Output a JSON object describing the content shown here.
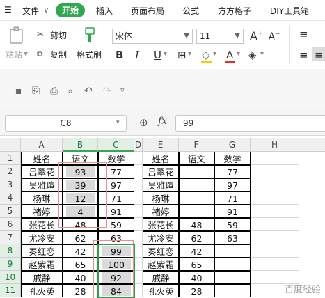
{
  "menu": {
    "file": "文件",
    "start": "开始",
    "items": [
      "插入",
      "页面布局",
      "公式",
      "方方格子",
      "DIY工具箱"
    ]
  },
  "ribbon": {
    "paste": "粘贴",
    "cut": "剪切",
    "copy": "复制",
    "format_painter": "格式刷",
    "font_name": "宋体",
    "font_size": "11",
    "bold": "B",
    "italic": "I",
    "underline": "U",
    "font_color_letter": "A"
  },
  "formula_bar": {
    "cell_ref": "C8",
    "fx": "fx",
    "value": "99"
  },
  "columns": [
    "A",
    "B",
    "C",
    "D",
    "E",
    "F",
    "G",
    "H"
  ],
  "rows": [
    "1",
    "2",
    "3",
    "4",
    "5",
    "6",
    "7",
    "8",
    "9",
    "10",
    "11"
  ],
  "left_table": {
    "headers": [
      "姓名",
      "语文",
      "数学"
    ],
    "rows": [
      [
        "吕翠花",
        "93",
        "77"
      ],
      [
        "吴雅瑄",
        "39",
        "97"
      ],
      [
        "杨琳",
        "12",
        "71"
      ],
      [
        "褚婷",
        "4",
        "91"
      ],
      [
        "张花长",
        "48",
        "59"
      ],
      [
        "尤冷安",
        "62",
        "63"
      ],
      [
        "秦红恋",
        "42",
        "99"
      ],
      [
        "赵紫霜",
        "65",
        "100"
      ],
      [
        "戚静",
        "40",
        "92"
      ],
      [
        "孔火英",
        "28",
        "84"
      ]
    ]
  },
  "right_table": {
    "headers": [
      "姓名",
      "语文",
      "数学"
    ],
    "rows": [
      [
        "吕翠花",
        "",
        "77"
      ],
      [
        "吴雅瑄",
        "",
        "97"
      ],
      [
        "杨琳",
        "",
        "71"
      ],
      [
        "褚婷",
        "",
        "91"
      ],
      [
        "张花长",
        "48",
        "59"
      ],
      [
        "尤冷安",
        "62",
        "63"
      ],
      [
        "秦红恋",
        "42",
        ""
      ],
      [
        "赵紫霜",
        "65",
        ""
      ],
      [
        "戚静",
        "40",
        ""
      ],
      [
        "孔火英",
        "28",
        ""
      ]
    ]
  },
  "watermark": "百度经验"
}
